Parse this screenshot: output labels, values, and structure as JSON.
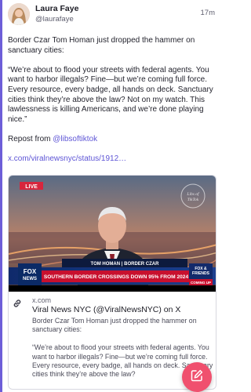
{
  "post": {
    "author_name": "Laura Faye",
    "author_handle": "@laurafaye",
    "time": "17m",
    "paragraphs": [
      "Border Czar Tom Homan just dropped the hammer on sanctuary cities:",
      "“We’re about to flood your streets with federal agents. You want to harbor illegals? Fine—but we’re coming full force. Every resource, every badge, all hands on deck. Sanctuary cities think they’re above the law? Not on my watch. This lawlessness is killing Americans, and we’re done playing nice.”"
    ],
    "repost_prefix": "Repost from ",
    "repost_link": "@libsoftiktok",
    "url": "x.com/viralnewsnyc/status/1912…"
  },
  "card": {
    "video": {
      "live_badge": "LIVE",
      "watermark_line1": "Libs of",
      "watermark_line2": "TikTok",
      "nameplate": "TOM HOMAN | BORDER CZAR",
      "network_line1": "FOX",
      "network_line2": "NEWS",
      "headline": "SOUTHERN BORDER CROSSINGS DOWN 95% FROM 2024",
      "promo_line1": "FOX &",
      "promo_line2": "FRIENDS",
      "promo_sub": "COMING UP"
    },
    "domain": "x.com",
    "title": "Viral News NYC (@ViralNewsNYC) on X",
    "description_paragraphs": [
      "Border Czar Tom Homan just dropped the hammer on sanctuary cities:",
      "“We’re about to flood your streets with federal agents. You want to harbor illegals? Fine—but we’re coming full force. Every resource, every badge, all hands on deck. Sanctuary cities think they’re above the law?"
    ]
  },
  "icons": {
    "link": "link-icon",
    "compose": "compose-icon"
  },
  "colors": {
    "accent": "#5e55d6",
    "fab": "#f0506e",
    "live": "#d7263d",
    "chyron": "#c8102e"
  }
}
